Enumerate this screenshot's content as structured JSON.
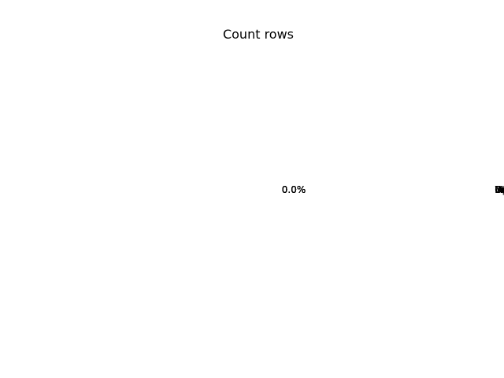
{
  "chart_data": {
    "type": "pie",
    "title": "Count rows",
    "categories": [
      "Docs",
      "Ops",
      "Messaging",
      "Core",
      "Bots",
      "Infra",
      "Web",
      "Mobile"
    ],
    "values": [
      0,
      0,
      0,
      0,
      0,
      0,
      0,
      0
    ],
    "percent_labels": [
      "0.0%",
      "0.0%",
      "0.0%",
      "0.0%",
      "0.0%",
      "0.0%",
      "0.0%",
      "0.0%"
    ],
    "colors": [
      "#1f77b4",
      "#ff7f0e",
      "#2ca02c",
      "#d62728",
      "#9467bd",
      "#8c564b",
      "#e377c2",
      "#7f7f7f"
    ],
    "legend": false
  }
}
